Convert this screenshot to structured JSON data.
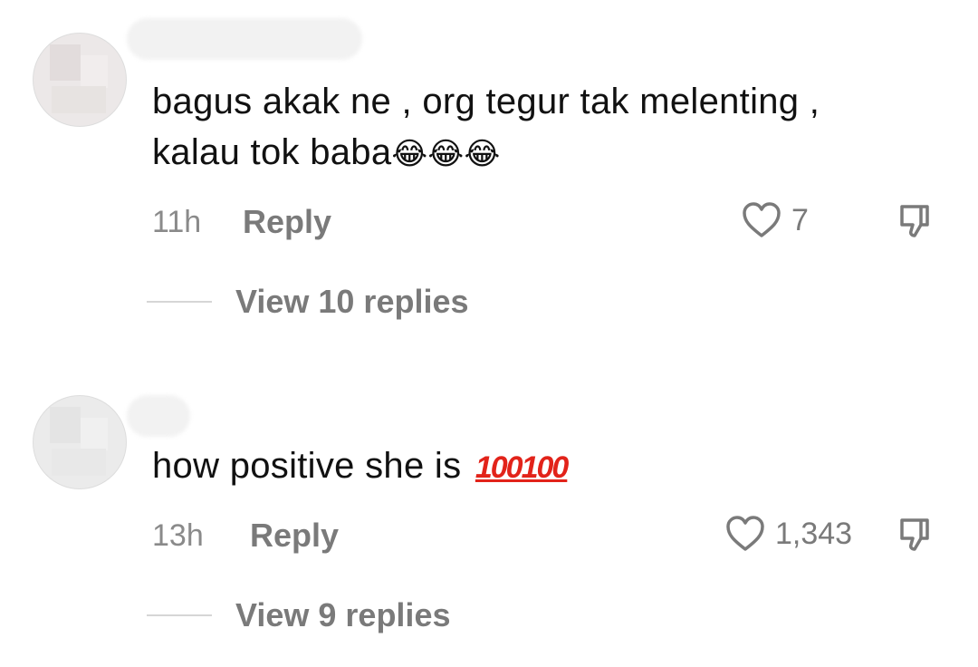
{
  "comments": [
    {
      "text": "bagus akak ne , org tegur tak melenting ,",
      "text_line2": "kalau tok baba",
      "emojis": "😂😂😂",
      "time": "11h",
      "reply_label": "Reply",
      "likes": "7",
      "view_replies": "View 10 replies"
    },
    {
      "text": "how positive she is",
      "emojis": "100100",
      "time": "13h",
      "reply_label": "Reply",
      "likes": "1,343",
      "view_replies": "View 9 replies"
    }
  ],
  "icons": {
    "like": "heart-outline-icon",
    "dislike": "thumbs-down-icon"
  },
  "colors": {
    "meta_gray": "#8a8a8a",
    "divider": "#d6d6d6",
    "hundred_red": "#e2231a"
  }
}
